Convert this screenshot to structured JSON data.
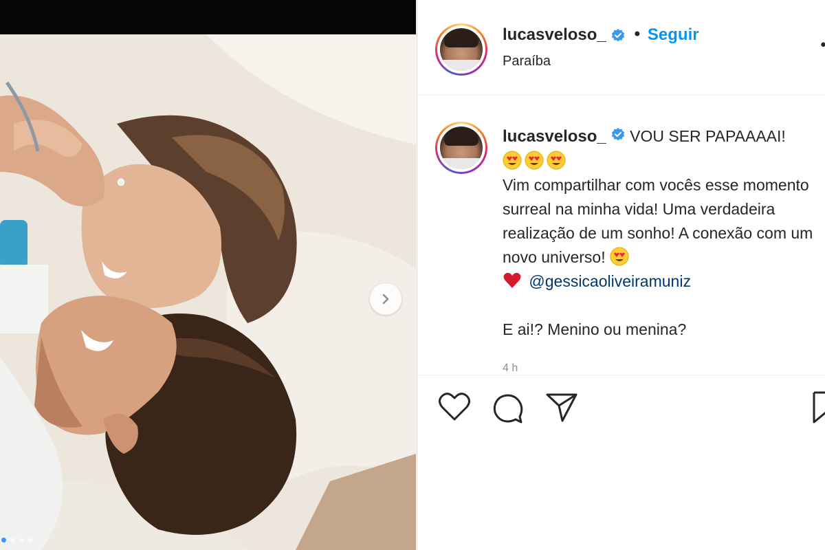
{
  "post": {
    "username": "lucasveloso_",
    "follow_label": "Seguir",
    "follow_separator": "•",
    "location": "Paraíba",
    "caption": {
      "username": "lucasveloso_",
      "headline": "VOU SER PAPAAAAI!",
      "body": "Vim compartilhar com vocês esse momento surreal na minha vida! Uma verdadeira realização de um sonho! A conexão com um novo universo!",
      "mention": "@gessicaoliveiramuniz",
      "question": "E ai!? Menino ou menina?"
    },
    "time_partial": "4 h"
  },
  "carousel": {
    "slide_count": 4,
    "active_index": 0
  },
  "icons": {
    "verified": "verified-badge-icon",
    "next": "chevron-right-icon",
    "like": "heart-icon",
    "comment": "comment-icon",
    "share": "paper-plane-icon",
    "save": "bookmark-icon",
    "more": "more-options-icon",
    "heart_eyes": "heart-eyes-emoji",
    "red_heart": "red-heart-emoji"
  },
  "colors": {
    "accent": "#0095f6",
    "verified": "#3897f0",
    "text": "#262626",
    "mention": "#00376b"
  }
}
